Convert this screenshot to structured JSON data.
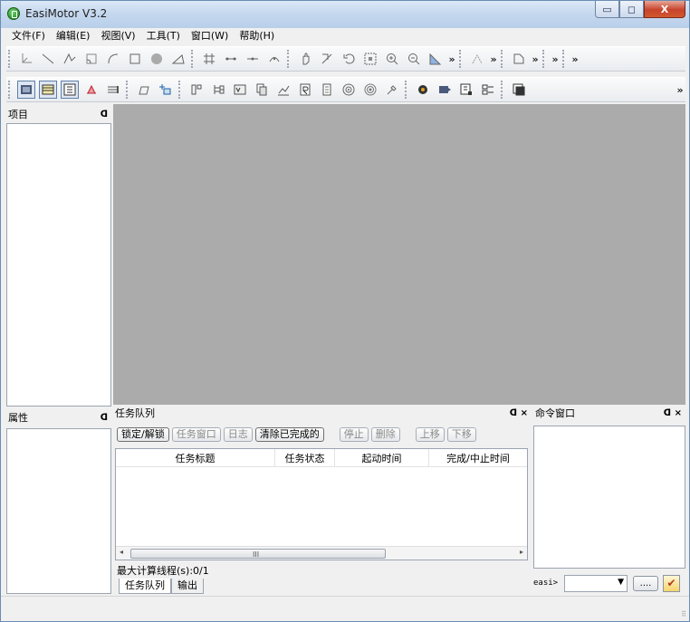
{
  "window": {
    "title": "EasiMotor V3.2",
    "controls": [
      "▭",
      "◻",
      "X"
    ]
  },
  "menu": [
    "文件(F)",
    "编辑(E)",
    "视图(V)",
    "工具(T)",
    "窗口(W)",
    "帮助(H)"
  ],
  "toolbar1": {
    "icons": [
      "coordinate-icon",
      "line-icon",
      "polyline-icon",
      "fillet-icon",
      "arc-icon",
      "rectangle-icon",
      "circle-icon",
      "polygon-icon",
      "grid-icon",
      "segment-icon",
      "segment-split-icon",
      "arc-point-icon",
      "pan-icon",
      "rotate-icon",
      "undo-view-icon",
      "zoom-fit-icon",
      "zoom-in-icon",
      "zoom-out-icon",
      "measure-icon"
    ],
    "more": "»"
  },
  "toolbar2": {
    "icons": [
      "motor-view-icon",
      "layout-view-icon",
      "list-view-icon",
      "material-icon",
      "winding-icon",
      "open-icon",
      "add-icon",
      "circuit-icon",
      "tree-icon",
      "variable-icon",
      "copy-icon",
      "chart-icon",
      "report-icon",
      "script-icon",
      "disc-icon",
      "target-icon",
      "tool-icon",
      "solver-icon",
      "result-icon",
      "export-icon",
      "settings-icon",
      "window-icon"
    ],
    "more": "»"
  },
  "project_panel": {
    "title": "项目",
    "pin": "ᗡ"
  },
  "property_panel": {
    "title": "属性",
    "pin": "ᗡ"
  },
  "task_panel": {
    "title": "任务队列",
    "pin": "ᗡ",
    "close": "×",
    "buttons": [
      "锁定/解锁",
      "任务窗口",
      "日志",
      "清除已完成的",
      "停止",
      "删除",
      "上移",
      "下移"
    ],
    "columns": [
      "任务标题",
      "任务状态",
      "起动时间",
      "完成/中止时间"
    ],
    "scroll_left": "◂",
    "scroll_right": "▸",
    "scroll_grip": "III",
    "threads": "最大计算线程(s):0/1",
    "tabs": [
      "任务队列",
      "输出"
    ]
  },
  "cmd_panel": {
    "title": "命令窗口",
    "pin": "ᗡ",
    "close": "×",
    "prompt": "easi>",
    "dropdown": "▼",
    "dots": "....",
    "exec": "✔"
  },
  "status": {
    "grip": "⠿"
  }
}
